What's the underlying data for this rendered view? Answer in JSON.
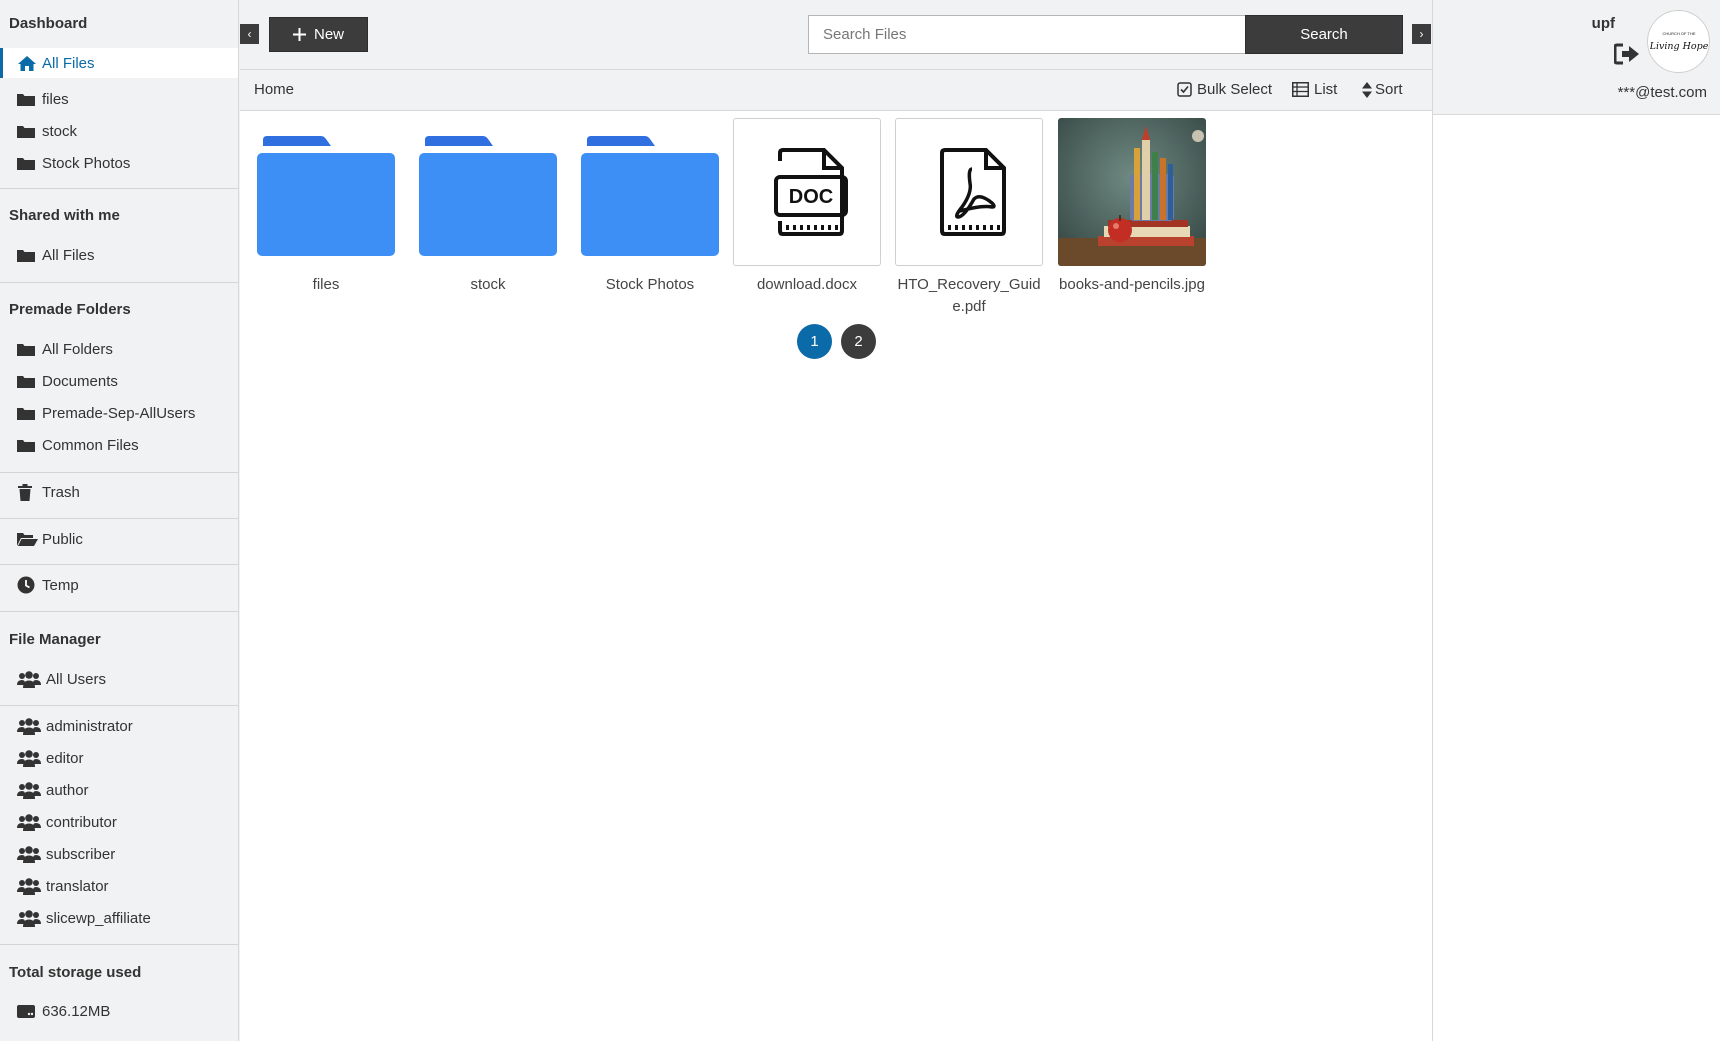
{
  "sidebar": {
    "dashboard": {
      "title": "Dashboard",
      "items": [
        {
          "label": "All Files",
          "icon": "home-icon",
          "active": true
        },
        {
          "label": "files",
          "icon": "folder-icon"
        },
        {
          "label": "stock",
          "icon": "folder-icon"
        },
        {
          "label": "Stock Photos",
          "icon": "folder-icon"
        }
      ]
    },
    "shared": {
      "title": "Shared with me",
      "items": [
        {
          "label": "All Files",
          "icon": "folder-icon"
        }
      ]
    },
    "premade": {
      "title": "Premade Folders",
      "items": [
        {
          "label": "All Folders",
          "icon": "folder-icon"
        },
        {
          "label": "Documents",
          "icon": "folder-icon"
        },
        {
          "label": "Premade-Sep-AllUsers",
          "icon": "folder-icon"
        },
        {
          "label": "Common Files",
          "icon": "folder-icon"
        }
      ]
    },
    "trash": {
      "label": "Trash",
      "icon": "trash-icon"
    },
    "public": {
      "label": "Public",
      "icon": "folder-open-icon"
    },
    "temp": {
      "label": "Temp",
      "icon": "clock-icon"
    },
    "file_manager": {
      "title": "File Manager",
      "all_users": {
        "label": "All Users",
        "icon": "users-icon"
      },
      "roles": [
        "administrator",
        "editor",
        "author",
        "contributor",
        "subscriber",
        "translator",
        "slicewp_affiliate"
      ]
    },
    "storage": {
      "title": "Total storage used",
      "value": "636.12MB",
      "icon": "hdd-icon"
    }
  },
  "toolbar": {
    "prev_icon": "‹",
    "next_icon": "›",
    "new_label": "New",
    "search_placeholder": "Search Files",
    "search_label": "Search"
  },
  "crumbbar": {
    "breadcrumb": "Home",
    "bulk_select_label": "Bulk Select",
    "list_label": "List",
    "sort_label": "Sort"
  },
  "files": [
    {
      "name": "files",
      "type": "folder"
    },
    {
      "name": "stock",
      "type": "folder"
    },
    {
      "name": "Stock Photos",
      "type": "folder"
    },
    {
      "name": "download.docx",
      "type": "doc",
      "badge": "DOC"
    },
    {
      "name": "HTO_Recovery_Guide.pdf",
      "type": "pdf"
    },
    {
      "name": "books-and-pencils.jpg",
      "type": "image"
    }
  ],
  "pagination": {
    "pages": [
      "1",
      "2"
    ],
    "current": "1"
  },
  "user": {
    "username": "upf",
    "email": "***@test.com",
    "logo_text": "Living Hope",
    "logo_small": "CHURCH OF THE"
  },
  "colors": {
    "accent": "#0b6aa8",
    "folder": "#3d8ff5",
    "folder_tab": "#2f6fe0",
    "dark_button": "#3c3c3c",
    "page_active": "#0b6aa8"
  }
}
